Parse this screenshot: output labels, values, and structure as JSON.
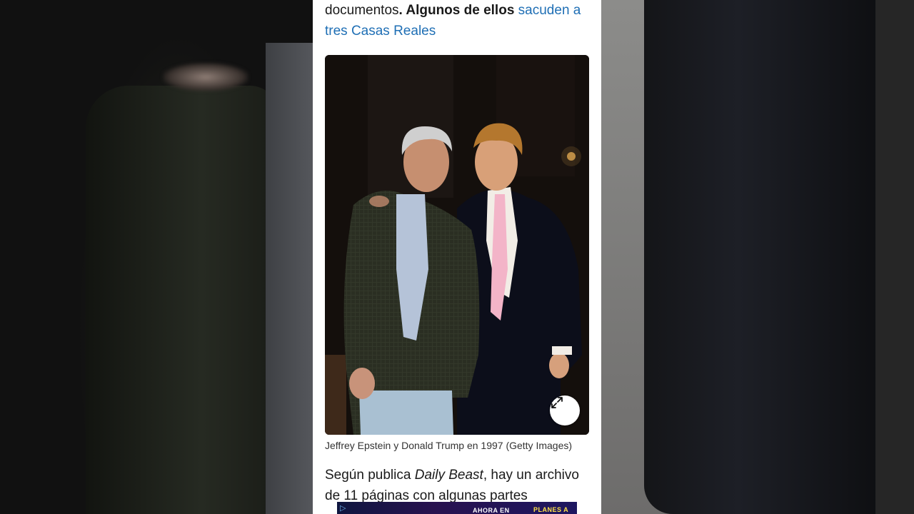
{
  "article": {
    "intro": {
      "text_plain": "documentos",
      "text_bold": ". Algunos de ellos",
      "link": "sacuden a tres Casas Reales"
    },
    "photo": {
      "alt": "Jeffrey Epstein y Donald Trump",
      "expand_icon": "expand-icon"
    },
    "caption": "Jeffrey Epstein y Donald Trump en 1997 (Getty Images)",
    "next_para": {
      "prefix": "Según publica ",
      "source": "Daily Beast",
      "suffix": ", hay un archivo de 11 páginas con algunas partes"
    },
    "ad": {
      "icon": "ad-choices-icon",
      "text1": "AHORA EN",
      "text2": "PLANES A"
    }
  },
  "colors": {
    "link": "#1f6fb5",
    "text": "#1a1a1a",
    "page_bg": "#ffffff"
  }
}
